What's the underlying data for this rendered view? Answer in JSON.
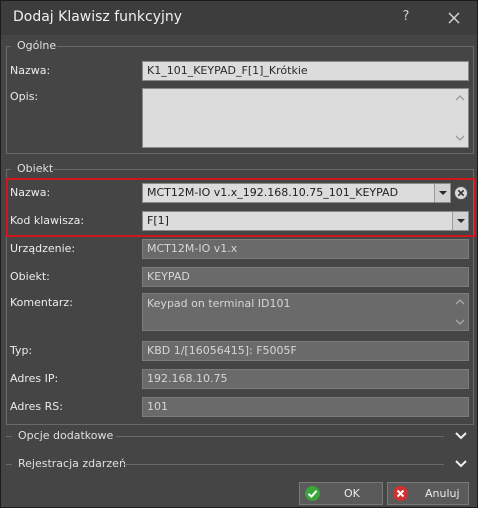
{
  "window": {
    "title": "Dodaj Klawisz funkcyjny",
    "help_glyph": "?"
  },
  "general": {
    "group_title": "Ogólne",
    "name_label": "Nazwa:",
    "name_value": "K1_101_KEYPAD_F[1]_Krótkie",
    "description_label": "Opis:",
    "description_value": ""
  },
  "object": {
    "group_title": "Obiekt",
    "name_label": "Nazwa:",
    "name_value": "MCT12M-IO v1.x_192.168.10.75_101_KEYPAD",
    "key_code_label": "Kod klawisza:",
    "key_code_value": "F[1]",
    "device_label": "Urządzenie:",
    "device_value": "MCT12M-IO v1.x",
    "object_label": "Obiekt:",
    "object_value": "KEYPAD",
    "comment_label": "Komentarz:",
    "comment_value": "Keypad on terminal ID101",
    "type_label": "Typ:",
    "type_value": "KBD 1/[16056415]: F5005F",
    "ip_label": "Adres IP:",
    "ip_value": "192.168.10.75",
    "rs_label": "Adres RS:",
    "rs_value": "101"
  },
  "sections": {
    "extra_options": "Opcje dodatkowe",
    "event_logging": "Rejestracja zdarzeń"
  },
  "buttons": {
    "ok": "OK",
    "cancel": "Anuluj"
  },
  "colors": {
    "highlight": "#d0161c",
    "ok_icon": "#3aa53a",
    "cancel_icon": "#d03030"
  }
}
